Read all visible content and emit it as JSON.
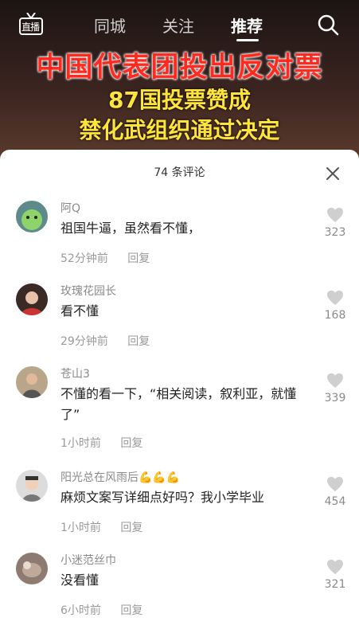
{
  "nav": {
    "live_label": "直播",
    "tabs": [
      {
        "label": "同城"
      },
      {
        "label": "关注"
      },
      {
        "label": "推荐"
      }
    ],
    "active_tab": "推荐",
    "search_icon": "search-icon"
  },
  "video": {
    "headline_1": "中国代表团投出反对票",
    "headline_2": "87国投票赞成",
    "headline_3": "禁化武组织通过决定"
  },
  "comments_panel": {
    "title": "74 条评论",
    "close_icon": "close-icon",
    "reply_label": "回复",
    "comments": [
      {
        "user": "阿Q",
        "text": "祖国牛逼，虽然看不懂，",
        "time": "52分钟前",
        "likes": "323"
      },
      {
        "user": "玫瑰花园长",
        "text": "看不懂",
        "time": "29分钟前",
        "likes": "168"
      },
      {
        "user": "苍山3",
        "text": "不懂的看一下，“相关阅读，叙利亚，就懂了”",
        "time": "1小时前",
        "likes": "339"
      },
      {
        "user": "阳光总在风雨后💪💪💪",
        "text": "麻烦文案写详细点好吗？我小学毕业",
        "time": "1小时前",
        "likes": "454"
      },
      {
        "user": "小迷范丝巾",
        "text": "没看懂",
        "time": "6小时前",
        "likes": "321"
      }
    ]
  },
  "colors": {
    "headline_red": "#ff2a1f",
    "headline_yellow": "#ffe43a",
    "like_gray": "#cfcfcf"
  }
}
